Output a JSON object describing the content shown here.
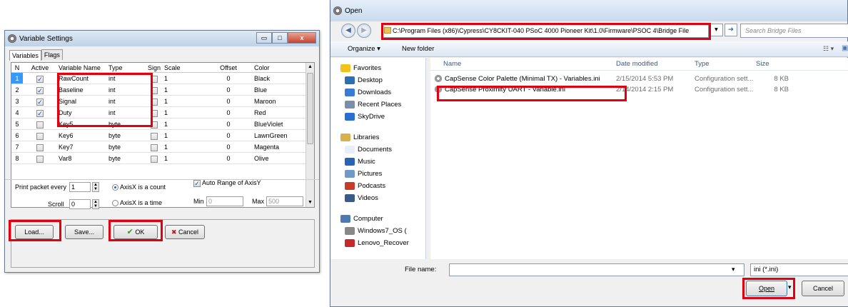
{
  "varset": {
    "title": "Variable Settings",
    "tabs": [
      "Variables",
      "Flags"
    ],
    "columns": [
      "N",
      "Active",
      "Variable Name",
      "Type",
      "Sign",
      "Scale",
      "Offset",
      "Color"
    ],
    "rows": [
      {
        "n": "1",
        "active": true,
        "name": "RawCount",
        "type": "int",
        "sign": false,
        "scale": "1",
        "offset": "0",
        "color": "Black"
      },
      {
        "n": "2",
        "active": true,
        "name": "Baseline",
        "type": "int",
        "sign": false,
        "scale": "1",
        "offset": "0",
        "color": "Blue"
      },
      {
        "n": "3",
        "active": true,
        "name": "Signal",
        "type": "int",
        "sign": false,
        "scale": "1",
        "offset": "0",
        "color": "Maroon"
      },
      {
        "n": "4",
        "active": true,
        "name": "Duty",
        "type": "int",
        "sign": false,
        "scale": "1",
        "offset": "0",
        "color": "Red"
      },
      {
        "n": "5",
        "active": false,
        "name": "Key5",
        "type": "byte",
        "sign": false,
        "scale": "1",
        "offset": "0",
        "color": "BlueViolet"
      },
      {
        "n": "6",
        "active": false,
        "name": "Key6",
        "type": "byte",
        "sign": false,
        "scale": "1",
        "offset": "0",
        "color": "LawnGreen"
      },
      {
        "n": "7",
        "active": false,
        "name": "Key7",
        "type": "byte",
        "sign": false,
        "scale": "1",
        "offset": "0",
        "color": "Magenta"
      },
      {
        "n": "8",
        "active": false,
        "name": "Var8",
        "type": "byte",
        "sign": false,
        "scale": "1",
        "offset": "0",
        "color": "Olive"
      }
    ],
    "print_label": "Print packet every",
    "print_value": "1",
    "scroll_label": "Scroll",
    "scroll_value": "0",
    "radio_count": "AxisX is a count",
    "radio_time": "AxisX is a time",
    "autorange_label": "Auto Range of AxisY",
    "min_label": "Min",
    "min_value": "0",
    "max_label": "Max",
    "max_value": "500",
    "load": "Load...",
    "save": "Save...",
    "ok": "OK",
    "cancel": "Cancel",
    "check_mark": "✓",
    "ok_icon": "✔",
    "cancel_icon": "✖",
    "spin_up": "▲",
    "spin_down": "▼",
    "min_glyph": "▭",
    "max_glyph": "□",
    "close_glyph": "x"
  },
  "opendlg": {
    "title": "Open",
    "address": "C:\\Program Files (x86)\\Cypress\\CY8CKIT-040 PSoC 4000 Pioneer Kit\\1.0\\Firmware\\PSOC 4\\Bridge File",
    "search_placeholder": "Search Bridge Files",
    "organize": "Organize ▾",
    "new_folder": "New folder",
    "back_glyph": "◀",
    "fwd_glyph": "▶",
    "dropdown_glyph": "▾",
    "go_glyph": "➔",
    "views_glyph": "☷ ▾",
    "pane_glyph": "▣",
    "nav": [
      {
        "label": "Favorites",
        "icon": "star-icon",
        "sub": false
      },
      {
        "label": "Desktop",
        "icon": "desktop-icon",
        "sub": true
      },
      {
        "label": "Downloads",
        "icon": "downloads-icon",
        "sub": true
      },
      {
        "label": "Recent Places",
        "icon": "recent-places-icon",
        "sub": true
      },
      {
        "label": "SkyDrive",
        "icon": "skydrive-icon",
        "sub": true
      },
      {
        "label": "",
        "icon": "",
        "sub": false
      },
      {
        "label": "Libraries",
        "icon": "libraries-icon",
        "sub": false
      },
      {
        "label": "Documents",
        "icon": "documents-icon",
        "sub": true
      },
      {
        "label": "Music",
        "icon": "music-icon",
        "sub": true
      },
      {
        "label": "Pictures",
        "icon": "pictures-icon",
        "sub": true
      },
      {
        "label": "Podcasts",
        "icon": "podcasts-icon",
        "sub": true
      },
      {
        "label": "Videos",
        "icon": "videos-icon",
        "sub": true
      },
      {
        "label": "",
        "icon": "",
        "sub": false
      },
      {
        "label": "Computer",
        "icon": "computer-icon",
        "sub": false
      },
      {
        "label": "Windows7_OS (",
        "icon": "drive-icon",
        "sub": true
      },
      {
        "label": "Lenovo_Recover",
        "icon": "recovery-drive-icon",
        "sub": true
      }
    ],
    "columns": {
      "name": "Name",
      "date": "Date modified",
      "type": "Type",
      "size": "Size"
    },
    "files": [
      {
        "name": "CapSense Color Palette (Minimal TX) - Variables.ini",
        "date": "2/15/2014 5:53 PM",
        "type": "Configuration sett...",
        "size": "8 KB"
      },
      {
        "name": "CapSense Proximity UART - Variable.ini",
        "date": "2/14/2014 2:15 PM",
        "type": "Configuration sett...",
        "size": "8 KB"
      }
    ],
    "filename_label": "File name:",
    "filename_value": "",
    "filter": "ini (*.ini)",
    "open": "Open",
    "cancel": "Cancel"
  },
  "colors": {
    "highlight": "#e0000f",
    "selection": "#3399ff"
  }
}
